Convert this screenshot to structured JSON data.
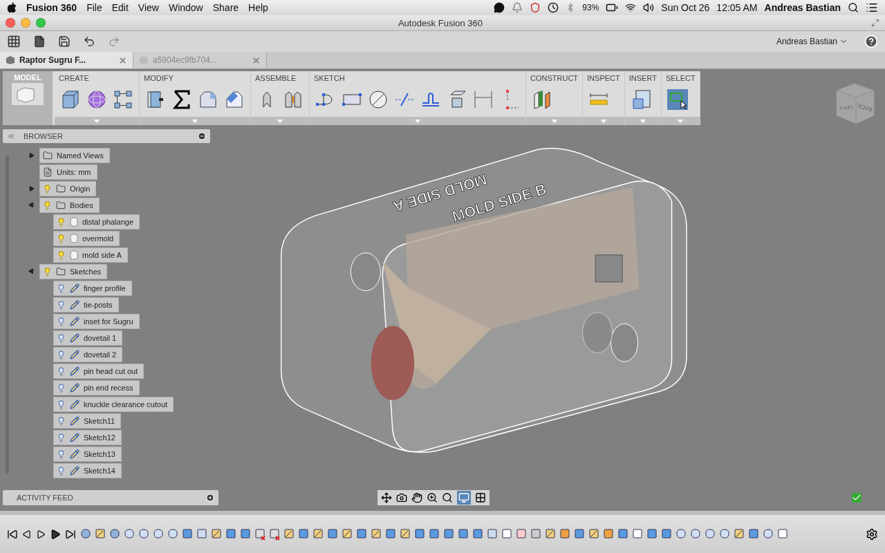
{
  "menubar": {
    "app": "Fusion 360",
    "menus": [
      "File",
      "Edit",
      "View",
      "Window",
      "Share",
      "Help"
    ],
    "battery": "93%",
    "date": "Sun Oct 26",
    "time": "12:05 AM",
    "user": "Andreas Bastian"
  },
  "window": {
    "title": "Autodesk Fusion 360"
  },
  "toolbar": {
    "user": "Andreas Bastian"
  },
  "tabs": [
    {
      "label": "Raptor Sugru F...",
      "selected": true
    },
    {
      "label": "a5904ec9fb704...",
      "selected": false
    }
  ],
  "ribbon": {
    "workspace": "MODEL",
    "groups": [
      {
        "label": "CREATE"
      },
      {
        "label": "MODIFY"
      },
      {
        "label": "ASSEMBLE"
      },
      {
        "label": "SKETCH"
      },
      {
        "label": "CONSTRUCT"
      },
      {
        "label": "INSPECT"
      },
      {
        "label": "INSERT"
      },
      {
        "label": "SELECT"
      }
    ]
  },
  "browser": {
    "title": "BROWSER",
    "tree": [
      {
        "label": "Named Views",
        "kind": "views",
        "expanded": false
      },
      {
        "label": "Units: mm",
        "kind": "units"
      },
      {
        "label": "Origin",
        "kind": "folder",
        "expanded": false,
        "visible": true
      },
      {
        "label": "Bodies",
        "kind": "folder",
        "expanded": true,
        "visible": true,
        "children": [
          {
            "label": "distal phalange",
            "kind": "body",
            "visible": true
          },
          {
            "label": "overmold",
            "kind": "body",
            "visible": true
          },
          {
            "label": "mold side A",
            "kind": "body",
            "visible": true
          }
        ]
      },
      {
        "label": "Sketches",
        "kind": "folder",
        "expanded": true,
        "visible": true,
        "children": [
          {
            "label": "finger profile",
            "kind": "sketch",
            "visible": false
          },
          {
            "label": "tie-posts",
            "kind": "sketch",
            "visible": false
          },
          {
            "label": "inset for Sugru",
            "kind": "sketch",
            "visible": false
          },
          {
            "label": "dovetail 1",
            "kind": "sketch",
            "visible": false
          },
          {
            "label": "dovetail 2",
            "kind": "sketch",
            "visible": false
          },
          {
            "label": "pin head cut out",
            "kind": "sketch",
            "visible": false
          },
          {
            "label": "pin end recess",
            "kind": "sketch",
            "visible": false
          },
          {
            "label": "knuckle clearance cutout",
            "kind": "sketch",
            "visible": false
          },
          {
            "label": "Sketch11",
            "kind": "sketch",
            "visible": false
          },
          {
            "label": "Sketch12",
            "kind": "sketch",
            "visible": false
          },
          {
            "label": "Sketch13",
            "kind": "sketch",
            "visible": false
          },
          {
            "label": "Sketch14",
            "kind": "sketch",
            "visible": false
          }
        ]
      }
    ]
  },
  "viewport": {
    "model_labels": [
      "MOLD SIDE A",
      "MOLD SIDE B"
    ],
    "view_cube": [
      "LEFT",
      "BACK"
    ]
  },
  "activity_feed": {
    "title": "ACTIVITY FEED"
  }
}
